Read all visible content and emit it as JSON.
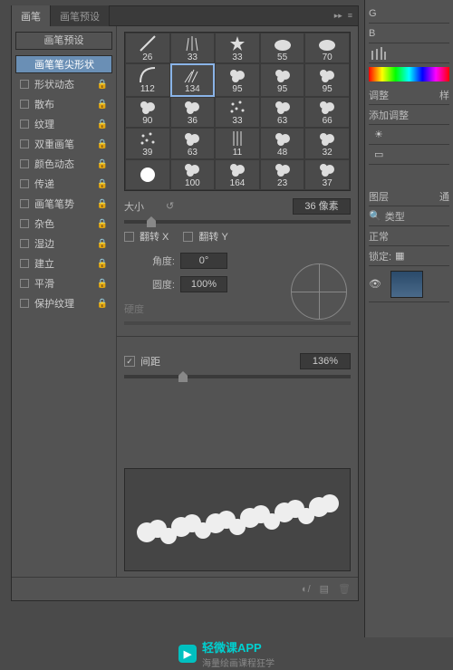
{
  "tabs": [
    "画笔",
    "画笔预设"
  ],
  "sidebar": {
    "preset_btn": "画笔预设",
    "items": [
      {
        "label": "画笔笔尖形状",
        "hasCheck": false,
        "hasLock": false,
        "active": true
      },
      {
        "label": "形状动态",
        "hasCheck": true,
        "hasLock": true
      },
      {
        "label": "散布",
        "hasCheck": true,
        "hasLock": true
      },
      {
        "label": "纹理",
        "hasCheck": true,
        "hasLock": true
      },
      {
        "label": "双重画笔",
        "hasCheck": true,
        "hasLock": true
      },
      {
        "label": "颜色动态",
        "hasCheck": true,
        "hasLock": true
      },
      {
        "label": "传递",
        "hasCheck": true,
        "hasLock": true
      },
      {
        "label": "画笔笔势",
        "hasCheck": true,
        "hasLock": true
      },
      {
        "label": "杂色",
        "hasCheck": true,
        "hasLock": true
      },
      {
        "label": "湿边",
        "hasCheck": true,
        "hasLock": true
      },
      {
        "label": "建立",
        "hasCheck": true,
        "hasLock": true
      },
      {
        "label": "平滑",
        "hasCheck": true,
        "hasLock": true
      },
      {
        "label": "保护纹理",
        "hasCheck": true,
        "hasLock": true
      }
    ]
  },
  "brushes": [
    26,
    33,
    33,
    55,
    70,
    112,
    134,
    95,
    95,
    95,
    90,
    36,
    33,
    63,
    66,
    39,
    63,
    11,
    48,
    32,
    "",
    100,
    164,
    23,
    37
  ],
  "selected_brush_index": 6,
  "controls": {
    "size_label": "大小",
    "size_value": "36 像素",
    "flip_x": "翻转 X",
    "flip_y": "翻转 Y",
    "angle_label": "角度:",
    "angle_value": "0°",
    "round_label": "圆度:",
    "round_value": "100%",
    "hardness_label": "硬度",
    "spacing_label": "间距",
    "spacing_value": "136%"
  },
  "right": {
    "letters": [
      "G",
      "B"
    ],
    "adjust_tab": "调整",
    "style_tab": "样",
    "add_adjust": "添加调整",
    "layers_tab": "图层",
    "channels_tab": "通",
    "type_label": "类型",
    "blend_mode": "正常",
    "lock_label": "锁定:"
  },
  "promo": {
    "name": "轻微课APP",
    "sub": "海量绘画课程狂学"
  }
}
